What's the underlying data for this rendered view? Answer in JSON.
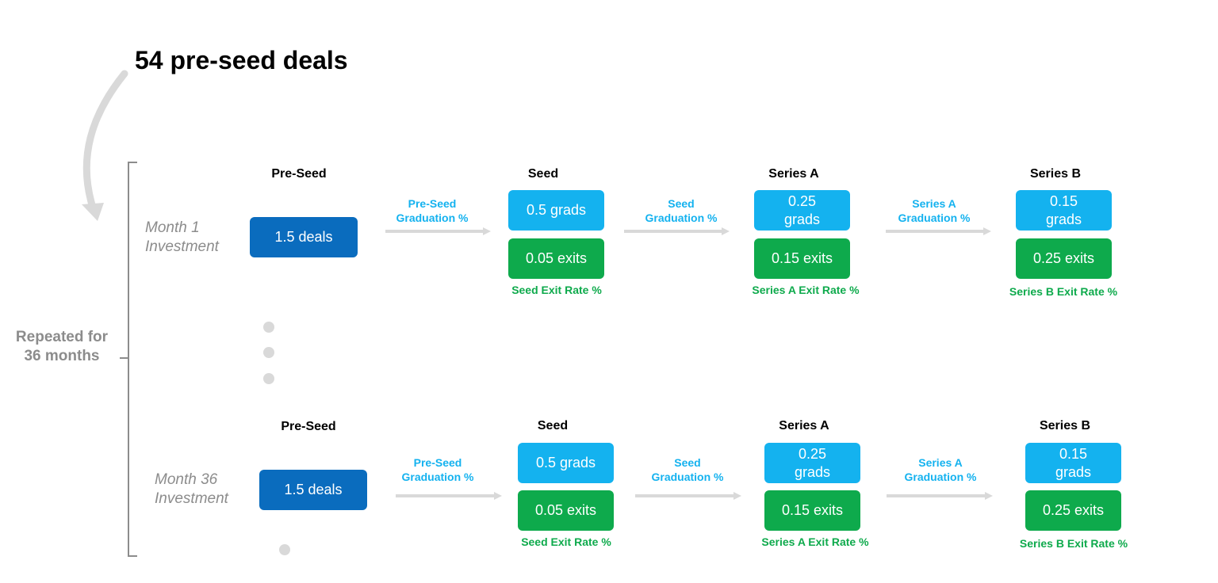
{
  "title": "54 pre-seed deals",
  "repeat_label": "Repeated for 36 months",
  "rows": [
    {
      "month_label": "Month 1\nInvestment",
      "preseed": {
        "stage": "Pre-Seed",
        "value": "1.5 deals"
      },
      "transitions": [
        {
          "label": "Pre-Seed\nGraduation %"
        },
        {
          "label": "Seed\nGraduation %"
        },
        {
          "label": "Series A\nGraduation %"
        }
      ],
      "stages": [
        {
          "stage": "Seed",
          "grads": "0.5 grads",
          "exits": "0.05 exits",
          "exit_label": "Seed Exit Rate %"
        },
        {
          "stage": "Series A",
          "grads": "0.25\ngrads",
          "exits": "0.15 exits",
          "exit_label": "Series A Exit Rate %"
        },
        {
          "stage": "Series B",
          "grads": "0.15\ngrads",
          "exits": "0.25 exits",
          "exit_label": "Series B Exit Rate %"
        }
      ]
    },
    {
      "month_label": "Month 36\nInvestment",
      "preseed": {
        "stage": "Pre-Seed",
        "value": "1.5 deals"
      },
      "transitions": [
        {
          "label": "Pre-Seed\nGraduation %"
        },
        {
          "label": "Seed\nGraduation %"
        },
        {
          "label": "Series A\nGraduation %"
        }
      ],
      "stages": [
        {
          "stage": "Seed",
          "grads": "0.5 grads",
          "exits": "0.05 exits",
          "exit_label": "Seed Exit Rate %"
        },
        {
          "stage": "Series A",
          "grads": "0.25\ngrads",
          "exits": "0.15 exits",
          "exit_label": "Series A Exit Rate %"
        },
        {
          "stage": "Series B",
          "grads": "0.15\ngrads",
          "exits": "0.25 exits",
          "exit_label": "Series B Exit Rate %"
        }
      ]
    }
  ],
  "colors": {
    "deals_box": "#0a6cbe",
    "grads_box": "#14b2ef",
    "exits_box": "#0eaa4c",
    "muted_gray": "#8c8c8c",
    "arrow_gray": "#d9d9d9"
  }
}
